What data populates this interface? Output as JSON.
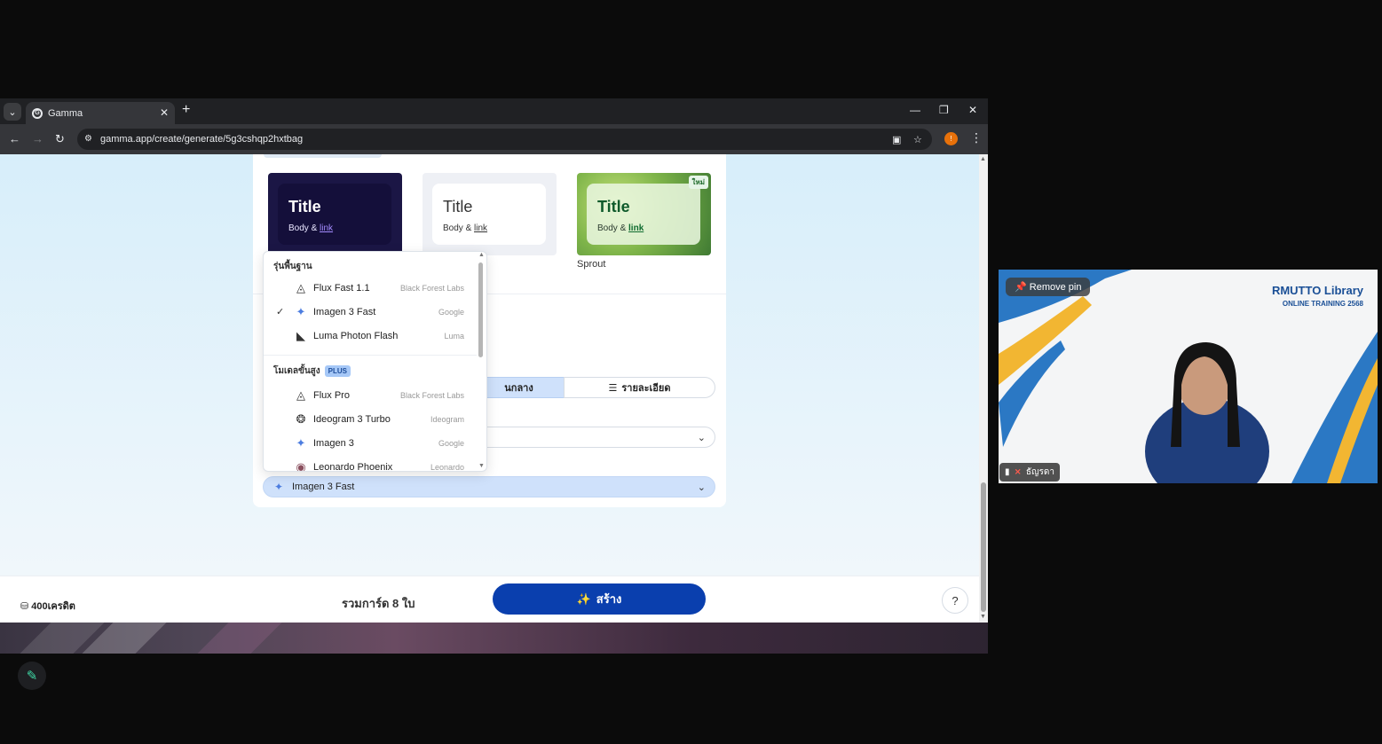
{
  "browser": {
    "tab_title": "Gamma",
    "url": "gamma.app/create/generate/5g3cshqp2hxtbag",
    "profile_initial": "!"
  },
  "themes": [
    {
      "title": "Title",
      "body": "Body &",
      "link": "link",
      "name": ""
    },
    {
      "title": "Title",
      "body": "Body &",
      "link": "link",
      "name": ""
    },
    {
      "title": "Title",
      "body": "Body &",
      "link": "link",
      "name": "Sprout",
      "badge": "ใหม่"
    }
  ],
  "segments": {
    "middle": "นกลาง",
    "detail": "รายละเอียด"
  },
  "image_model_select": "Imagen 3 Fast",
  "dropdown": {
    "basic_header": "รุ่นพื้นฐาน",
    "advanced_header": "โมเดลขั้นสูง",
    "plus_badge": "PLUS",
    "basic_items": [
      {
        "label": "Flux Fast 1.1",
        "vendor": "Black Forest Labs",
        "icon": "flux-icon",
        "checked": false
      },
      {
        "label": "Imagen 3 Fast",
        "vendor": "Google",
        "icon": "gemini-star-icon",
        "checked": true
      },
      {
        "label": "Luma Photon Flash",
        "vendor": "Luma",
        "icon": "luma-icon",
        "checked": false
      }
    ],
    "advanced_items": [
      {
        "label": "Flux Pro",
        "vendor": "Black Forest Labs",
        "icon": "flux-icon"
      },
      {
        "label": "Ideogram 3 Turbo",
        "vendor": "Ideogram",
        "icon": "ideogram-icon"
      },
      {
        "label": "Imagen 3",
        "vendor": "Google",
        "icon": "gemini-star-icon"
      },
      {
        "label": "Leonardo Phoenix",
        "vendor": "Leonardo",
        "icon": "leonardo-icon"
      }
    ]
  },
  "footer": {
    "credits": "400เครดิต",
    "total_cards": "รวมการ์ด 8 ใบ",
    "create_label": "สร้าง",
    "help": "?"
  },
  "video": {
    "remove_pin": "Remove pin",
    "brand_title": "RMUTTO Library",
    "brand_sub": "ONLINE TRAINING 2568",
    "participant": "ธัญรดา"
  },
  "colors": {
    "accent": "#0a3fae",
    "select_bg": "#cfe1fb"
  }
}
